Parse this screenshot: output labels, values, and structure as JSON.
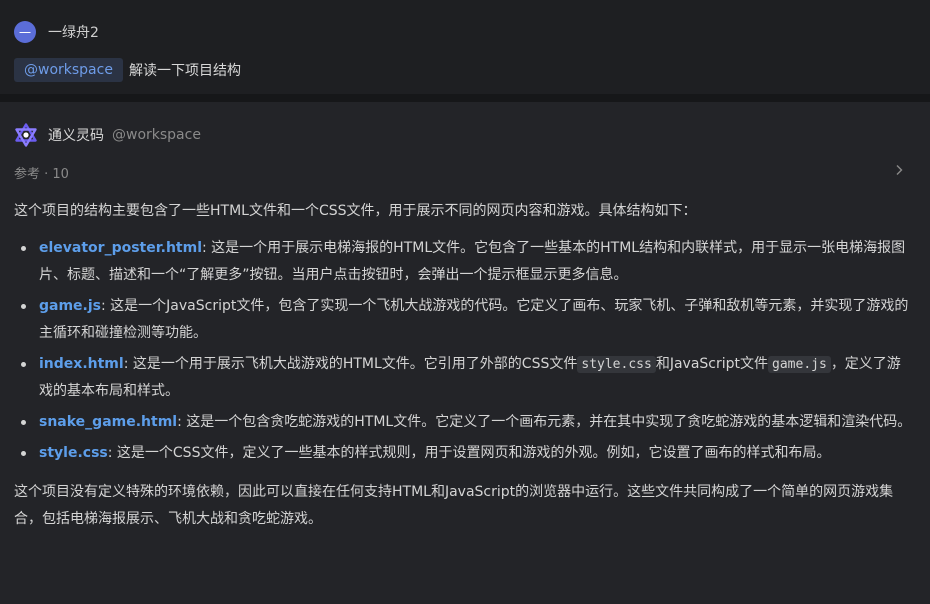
{
  "user": {
    "avatar_glyph": "一",
    "name": "一绿舟2",
    "tag": "@workspace",
    "query": "解读一下项目结构"
  },
  "bot": {
    "name": "通义灵码",
    "scope": "@workspace",
    "refs_label": "参考 · 10",
    "logo_icon": "tongyi-logo-icon",
    "accent": "#6b5cf0"
  },
  "answer": {
    "intro": "这个项目的结构主要包含了一些HTML文件和一个CSS文件，用于展示不同的网页内容和游戏。具体结构如下：",
    "items": [
      {
        "file": "elevator_poster.html",
        "desc_a": ": 这是一个用于展示电梯海报的HTML文件。它包含了一些基本的HTML结构和内联样式，用于显示一张电梯海报图片、标题、描述和一个“了解更多”按钮。当用户点击按钮时，会弹出一个提示框显示更多信息。",
        "code1": "",
        "desc_b": "",
        "code2": "",
        "desc_c": ""
      },
      {
        "file": "game.js",
        "desc_a": ": 这是一个JavaScript文件，包含了实现一个飞机大战游戏的代码。它定义了画布、玩家飞机、子弹和敌机等元素，并实现了游戏的主循环和碰撞检测等功能。",
        "code1": "",
        "desc_b": "",
        "code2": "",
        "desc_c": ""
      },
      {
        "file": "index.html",
        "desc_a": ": 这是一个用于展示飞机大战游戏的HTML文件。它引用了外部的CSS文件",
        "code1": "style.css",
        "desc_b": "和JavaScript文件",
        "code2": "game.js",
        "desc_c": "，定义了游戏的基本布局和样式。"
      },
      {
        "file": "snake_game.html",
        "desc_a": ": 这是一个包含贪吃蛇游戏的HTML文件。它定义了一个画布元素，并在其中实现了贪吃蛇游戏的基本逻辑和渲染代码。",
        "code1": "",
        "desc_b": "",
        "code2": "",
        "desc_c": ""
      },
      {
        "file": "style.css",
        "desc_a": ": 这是一个CSS文件，定义了一些基本的样式规则，用于设置网页和游戏的外观。例如，它设置了画布的样式和布局。",
        "code1": "",
        "desc_b": "",
        "code2": "",
        "desc_c": ""
      }
    ],
    "summary": "这个项目没有定义特殊的环境依赖，因此可以直接在任何支持HTML和JavaScript的浏览器中运行。这些文件共同构成了一个简单的网页游戏集合，包括电梯海报展示、飞机大战和贪吃蛇游戏。"
  }
}
